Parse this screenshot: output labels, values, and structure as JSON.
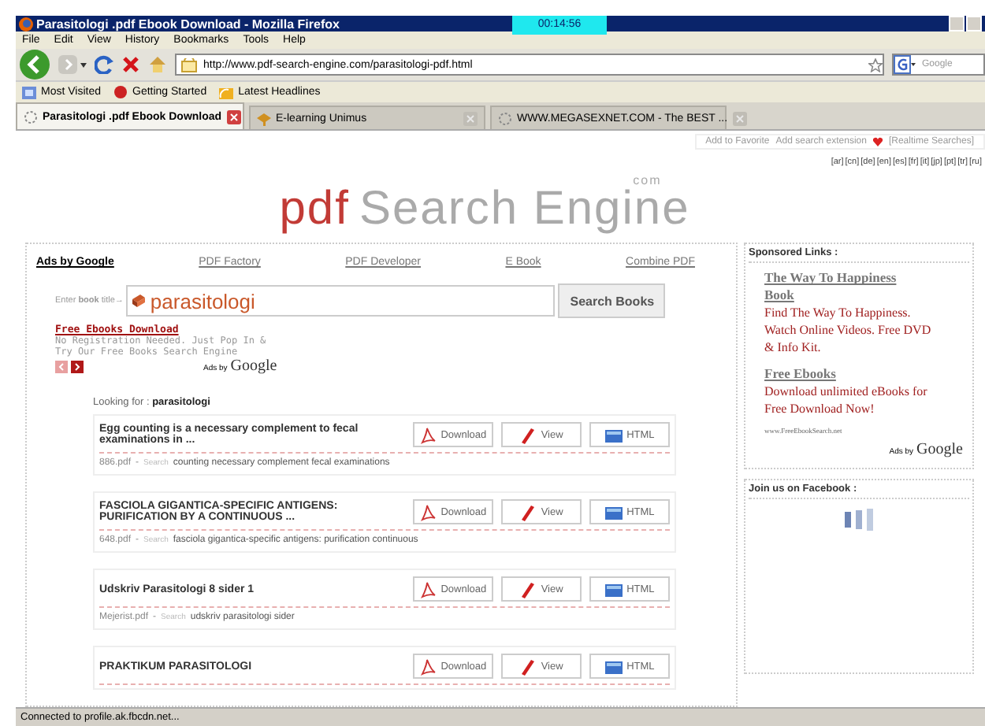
{
  "window": {
    "title": "Parasitologi .pdf Ebook Download - Mozilla Firefox",
    "clock": "00:14:56"
  },
  "menu": [
    "File",
    "Edit",
    "View",
    "History",
    "Bookmarks",
    "Tools",
    "Help"
  ],
  "toolbar": {
    "url": "http://www.pdf-search-engine.com/parasitologi-pdf.html",
    "search_placeholder": "Google"
  },
  "bookmarks": [
    "Most Visited",
    "Getting Started",
    "Latest Headlines"
  ],
  "tabs": [
    {
      "label": "Parasitologi .pdf Ebook Download",
      "selected": true
    },
    {
      "label": "E-learning Unimus",
      "selected": false
    },
    {
      "label": "WWW.MEGASEXNET.COM - The BEST ...",
      "selected": false
    }
  ],
  "top_links": [
    "Add to Favorite",
    "Add search extension",
    "[Realtime Searches]"
  ],
  "languages": [
    "[ar]",
    "[cn]",
    "[de]",
    "[en]",
    "[es]",
    "[fr]",
    "[it]",
    "[jp]",
    "[pt]",
    "[tr]",
    "[ru]"
  ],
  "logo": {
    "prefix": "pdf",
    "name": "Search Engine",
    "suffix": "com"
  },
  "nav_links": [
    {
      "label": "Ads by Google",
      "kind": "heading"
    },
    {
      "label": "PDF Factory",
      "kind": "link"
    },
    {
      "label": "PDF Developer",
      "kind": "link"
    },
    {
      "label": "E Book",
      "kind": "link"
    },
    {
      "label": "Combine PDF",
      "kind": "link"
    }
  ],
  "search": {
    "label": "Enter **book** title→",
    "value": "parasitologi",
    "button": "Search Books"
  },
  "ad": {
    "title": "Free Ebooks Download",
    "lines": [
      "No Registration Needed. Just Pop In &",
      "Try Our Free Books Search Engine"
    ],
    "ads_label": "Ads by",
    "ads_brand": "Google"
  },
  "looking_for": {
    "label": "Looking for :",
    "query": "parasitologi"
  },
  "results": [
    {
      "title": "Egg counting is a necessary complement to fecal examinations in ...",
      "file": "886.pdf",
      "separator": "-",
      "search_label": "Search",
      "keywords": "counting necessary complement fecal examinations",
      "buttons": [
        "Download",
        "View",
        "HTML"
      ]
    },
    {
      "title": "FASCIOLA GIGANTICA-SPECIFIC ANTIGENS: PURIFICATION BY A CONTINUOUS ...",
      "file": "648.pdf",
      "separator": "-",
      "search_label": "Search",
      "keywords": "fasciola gigantica-specific antigens: purification continuous",
      "buttons": [
        "Download",
        "View",
        "HTML"
      ]
    },
    {
      "title": "Udskriv Parasitologi 8 sider 1",
      "file": "Mejerist.pdf",
      "separator": "-",
      "search_label": "Search",
      "keywords": "udskriv parasitologi sider",
      "buttons": [
        "Download",
        "View",
        "HTML"
      ]
    },
    {
      "title": "PRAKTIKUM PARASITOLOGI",
      "buttons": [
        "Download",
        "View",
        "HTML"
      ]
    }
  ],
  "sponsored": {
    "title": "Sponsored Links :",
    "ads": [
      {
        "title": "The Way To Happiness Book",
        "body": "Find The Way To Happiness. Watch Online Videos. Free DVD & Info Kit."
      },
      {
        "title": "Free Ebooks",
        "body": "Download unlimited eBooks for Free Download Now!"
      }
    ],
    "url": "www.FreeEbookSearch.net",
    "ads_label": "Ads by",
    "ads_brand": "Google"
  },
  "facebook": {
    "title": "Join us on Facebook :"
  },
  "status_bar": "Connected to profile.ak.fbcdn.net..."
}
